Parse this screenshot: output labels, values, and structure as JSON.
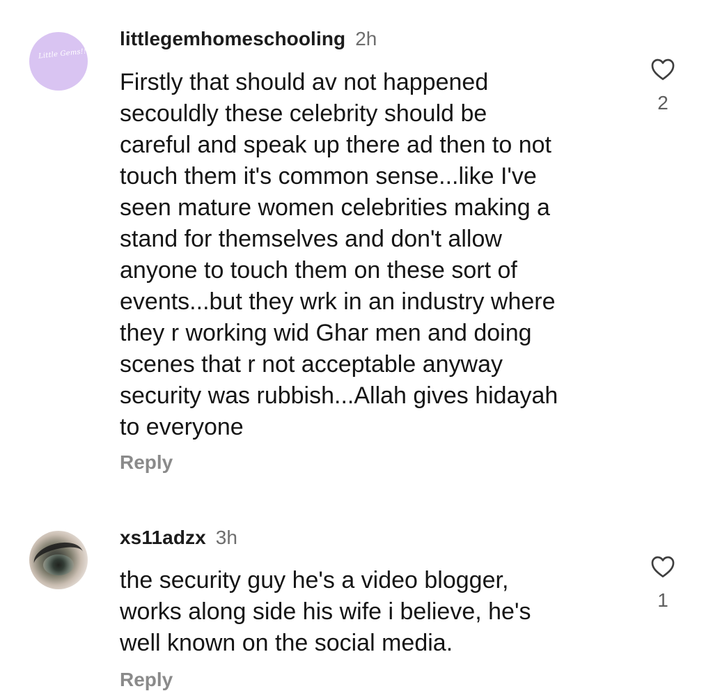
{
  "comments": [
    {
      "avatar": {
        "text": "Little Gems!!",
        "color": "#d9c4f2"
      },
      "username": "littlegemhomeschooling",
      "time": "2h",
      "text": "Firstly that should av not happened\nsecouldly these celebrity should be\ncareful and speak up there ad then to not\ntouch them it's common sense...like I've\nseen mature women celebrities making a\nstand for themselves and don't allow\nanyone to touch them on these sort of\nevents...but they wrk in an industry where\nthey r working wid Ghar men and doing\nscenes that r not acceptable anyway\nsecurity was rubbish...Allah gives hidayah\nto everyone",
      "likes": "2",
      "reply_label": "Reply",
      "like_icon": "heart-outline-icon"
    },
    {
      "avatar": {
        "text": "",
        "color": "#8b8172"
      },
      "username": "xs11adzx",
      "time": "3h",
      "text": "the security guy he's a video blogger,\nworks along side his wife i believe, he's\nwell known on the social media.",
      "likes": "1",
      "reply_label": "Reply",
      "like_icon": "heart-outline-icon"
    }
  ]
}
